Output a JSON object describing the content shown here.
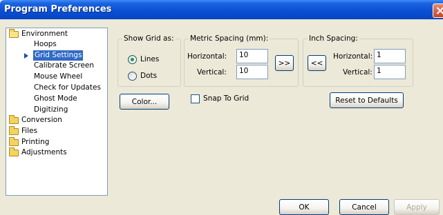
{
  "window": {
    "title": "Program Preferences"
  },
  "tree": {
    "categories": [
      {
        "label": "Environment",
        "items": [
          "Hoops",
          "Grid Settings",
          "Calibrate Screen",
          "Mouse Wheel",
          "Check for Updates",
          "Ghost Mode",
          "Digitizing"
        ]
      },
      {
        "label": "Conversion"
      },
      {
        "label": "Files"
      },
      {
        "label": "Printing"
      },
      {
        "label": "Adjustments"
      }
    ],
    "selected": "Grid Settings"
  },
  "grid": {
    "show_grid_label": "Show Grid as:",
    "lines_label": "Lines",
    "dots_label": "Dots",
    "selected_mode": "Lines",
    "color_button": "Color..."
  },
  "metric": {
    "label": "Metric Spacing (mm):",
    "horizontal_label": "Horizontal:",
    "horizontal_value": "10",
    "vertical_label": "Vertical:",
    "vertical_value": "10",
    "convert_button": ">>"
  },
  "inch": {
    "label": "Inch Spacing:",
    "horizontal_label": "Horizontal:",
    "horizontal_value": "1",
    "vertical_label": "Vertical:",
    "vertical_value": "1",
    "convert_button": "<<"
  },
  "snap": {
    "label": "Snap To Grid",
    "checked": false
  },
  "reset_button": "Reset to Defaults",
  "footer": {
    "ok": "OK",
    "cancel": "Cancel",
    "apply": "Apply"
  }
}
